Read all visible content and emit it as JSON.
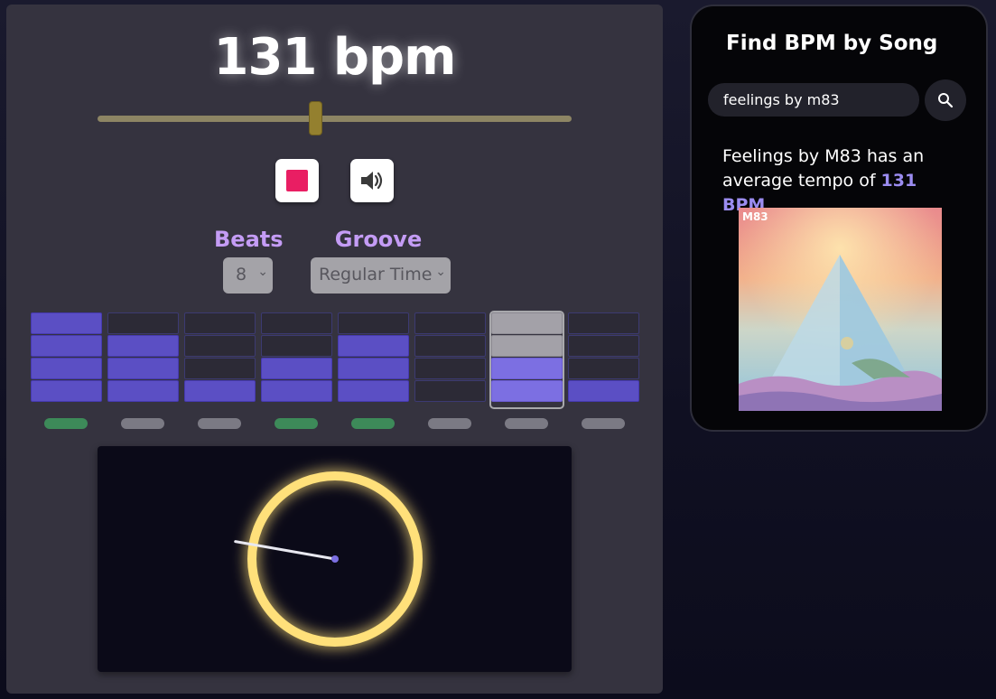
{
  "metronome": {
    "bpm_display": "131 bpm",
    "tempo_bpm": 131,
    "slider_value_fraction": 0.46,
    "controls": {
      "stop_icon": "stop-icon",
      "sound_icon": "speaker-icon"
    },
    "beats": {
      "label": "Beats",
      "selected": "8"
    },
    "groove": {
      "label": "Groove",
      "selected": "Regular Time"
    },
    "grid": {
      "columns": 8,
      "rows": 4,
      "active_column_index": 6,
      "filled_from_bottom": [
        4,
        3,
        1,
        2,
        3,
        0,
        2,
        1
      ],
      "indicator_pills": [
        "green",
        "gray",
        "gray",
        "green",
        "green",
        "gray",
        "gray",
        "gray"
      ]
    },
    "dial": {
      "needle_angle_deg": 190
    },
    "colors": {
      "accent_purple": "#c49cf5",
      "cell_on": "#5b4fc4",
      "stop_red": "#e91e63",
      "ring_yellow": "#ffe07a"
    }
  },
  "song_search": {
    "title": "Find BPM by Song",
    "query": "feelings by m83",
    "search_icon": "search-icon",
    "result_prefix": "Feelings by M83 has an average tempo of ",
    "result_bpm": "131 BPM",
    "result_suffix": ".",
    "album_art_text": "M83"
  }
}
